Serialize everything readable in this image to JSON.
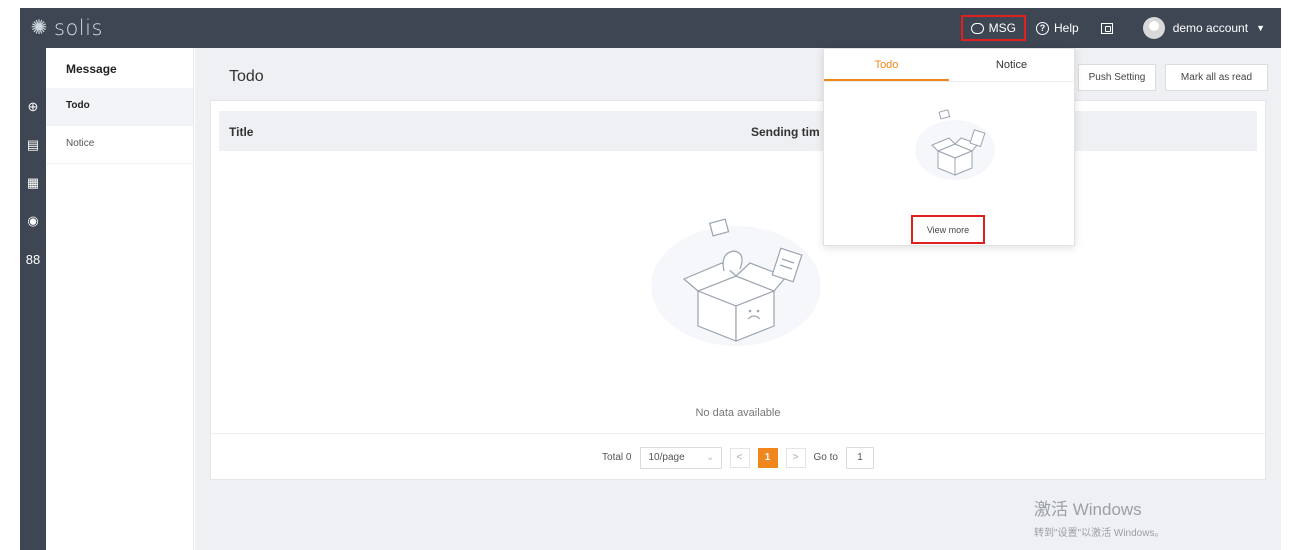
{
  "app": {
    "name": "solis"
  },
  "topbar": {
    "msg_label": "MSG",
    "help_label": "Help",
    "account_label": "demo account"
  },
  "rail": {
    "icons": [
      "globe-icon",
      "document-icon",
      "chart-icon",
      "eye-icon",
      "apps-icon"
    ]
  },
  "submenu": {
    "title": "Message",
    "items": [
      {
        "label": "Todo",
        "active": true
      },
      {
        "label": "Notice",
        "active": false
      }
    ]
  },
  "content": {
    "title": "Todo",
    "push_setting_label": "Push Setting",
    "mark_all_label": "Mark all as read",
    "table": {
      "columns": [
        "Title",
        "Sending tim"
      ],
      "empty_text": "No data available"
    },
    "pager": {
      "total_label": "Total 0",
      "page_size": "10/page",
      "prev": "<",
      "current_page": "1",
      "next": ">",
      "goto_label": "Go to",
      "goto_value": "1"
    }
  },
  "popover": {
    "tabs": [
      {
        "label": "Todo",
        "active": true
      },
      {
        "label": "Notice",
        "active": false
      }
    ],
    "view_more_label": "View more"
  },
  "watermark": {
    "line1": "激活 Windows",
    "line2": "转到\"设置\"以激活 Windows。"
  },
  "colors": {
    "topbar": "#3d4652",
    "accent": "#f0871e",
    "highlight_border": "#e02020"
  }
}
